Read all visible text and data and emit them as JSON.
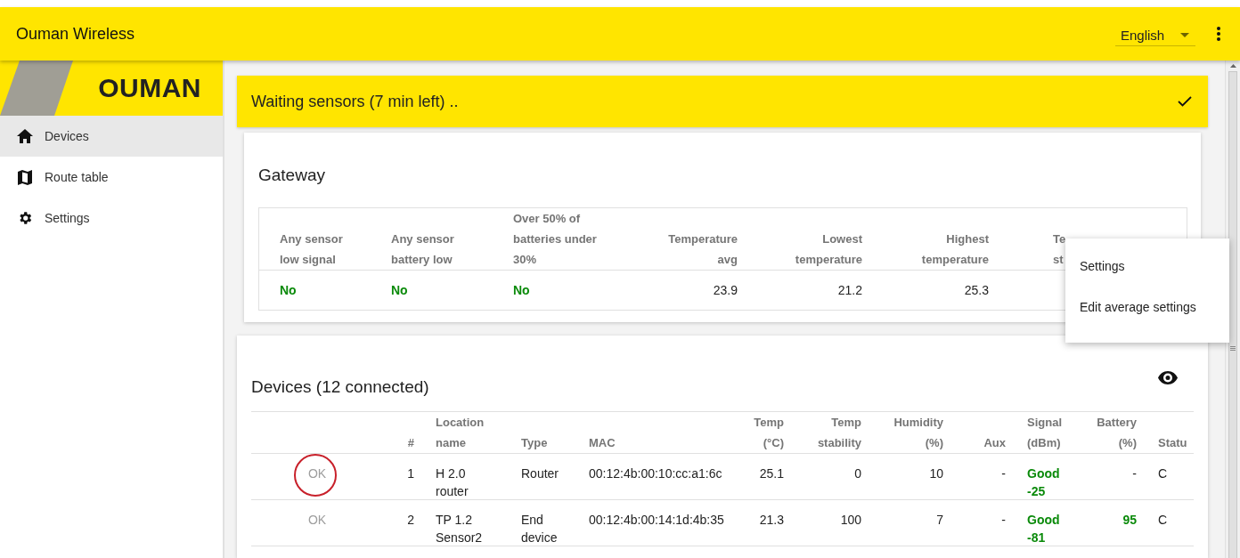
{
  "app_bar": {
    "title": "Ouman Wireless",
    "language": {
      "value": "English"
    }
  },
  "sidebar": {
    "logo": "OUMAN",
    "items": [
      {
        "label": "Devices",
        "selected": true
      },
      {
        "label": "Route table",
        "selected": false
      },
      {
        "label": "Settings",
        "selected": false
      }
    ]
  },
  "banner": {
    "text": "Waiting sensors (7 min left) .."
  },
  "gateway": {
    "title": "Gateway",
    "columns": [
      "Any sensor\nlow signal",
      "Any sensor\nbattery low",
      "Over 50% of\nbatteries under\n30%",
      "Temperature\navg",
      "Lowest\ntemperature",
      "Highest\ntemperature",
      "Te\nst"
    ],
    "row": [
      {
        "text": "No",
        "good": true
      },
      {
        "text": "No",
        "good": true
      },
      {
        "text": "No",
        "good": true
      },
      {
        "text": "23.9",
        "good": false
      },
      {
        "text": "21.2",
        "good": false
      },
      {
        "text": "25.3",
        "good": false
      }
    ]
  },
  "context_menu": {
    "items": [
      "Settings",
      "Edit average settings"
    ]
  },
  "devices": {
    "title": "Devices (12 connected)",
    "columns": [
      {},
      {
        "label": "#"
      },
      {
        "label": "Location\nname"
      },
      {
        "label": "Type"
      },
      {
        "label": "MAC"
      },
      {
        "label": "Temp\n(°C)"
      },
      {
        "label": "Temp\nstability"
      },
      {
        "label": "Humidity\n(%)"
      },
      {
        "label": "Aux"
      },
      {
        "label": "Signal\n(dBm)"
      },
      {
        "label": "Battery\n(%)"
      },
      {
        "label": "Statu"
      }
    ],
    "rows": [
      {
        "cells": [
          {
            "text": "OK",
            "good": false,
            "circled": true
          },
          {
            "text": "1",
            "good": false
          },
          {
            "text": "H 2.0\nrouter",
            "good": false
          },
          {
            "text": "Router",
            "good": false
          },
          {
            "text": "00:12:4b:00:10:cc:a1:6c",
            "good": false
          },
          {
            "text": "25.1",
            "good": false
          },
          {
            "text": "0",
            "good": false
          },
          {
            "text": "10",
            "good": false
          },
          {
            "text": "-",
            "good": false
          },
          {
            "text": "Good\n-25",
            "good": true
          },
          {
            "text": "-",
            "good": false
          },
          {
            "text": "C",
            "good": false
          }
        ]
      },
      {
        "cells": [
          {
            "text": "OK",
            "good": false,
            "circled": false
          },
          {
            "text": "2",
            "good": false
          },
          {
            "text": "TP 1.2\nSensor2",
            "good": false
          },
          {
            "text": "End\ndevice",
            "good": false
          },
          {
            "text": "00:12:4b:00:14:1d:4b:35",
            "good": false
          },
          {
            "text": "21.3",
            "good": false
          },
          {
            "text": "100",
            "good": false
          },
          {
            "text": "7",
            "good": false
          },
          {
            "text": "-",
            "good": false
          },
          {
            "text": "Good\n-81",
            "good": true
          },
          {
            "text": "95",
            "good": true
          },
          {
            "text": "C",
            "good": false
          }
        ]
      }
    ]
  }
}
